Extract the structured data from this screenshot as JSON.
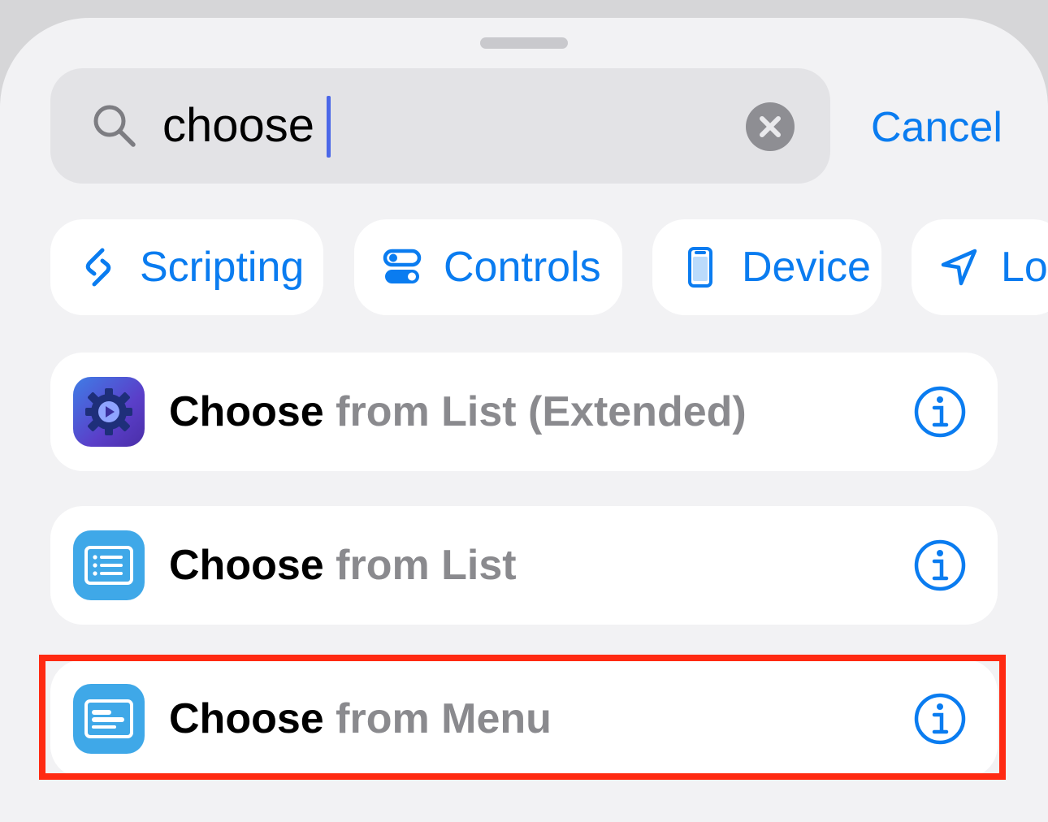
{
  "search": {
    "query": "choose"
  },
  "cancel_label": "Cancel",
  "categories": [
    {
      "label": "Scripting",
      "icon": "scripting-icon"
    },
    {
      "label": "Controls",
      "icon": "toggle-icon"
    },
    {
      "label": "Device",
      "icon": "phone-icon"
    },
    {
      "label": "Loc",
      "icon": "location-arrow-icon"
    }
  ],
  "results": [
    {
      "bold": "Choose",
      "rest": " from List (Extended)",
      "icon": "gear-app-icon"
    },
    {
      "bold": "Choose",
      "rest": " from List",
      "icon": "list-app-icon"
    },
    {
      "bold": "Choose",
      "rest": " from Menu",
      "icon": "menu-app-icon"
    }
  ],
  "colors": {
    "accent": "#0a7cf0",
    "highlight": "#ff2a12"
  }
}
